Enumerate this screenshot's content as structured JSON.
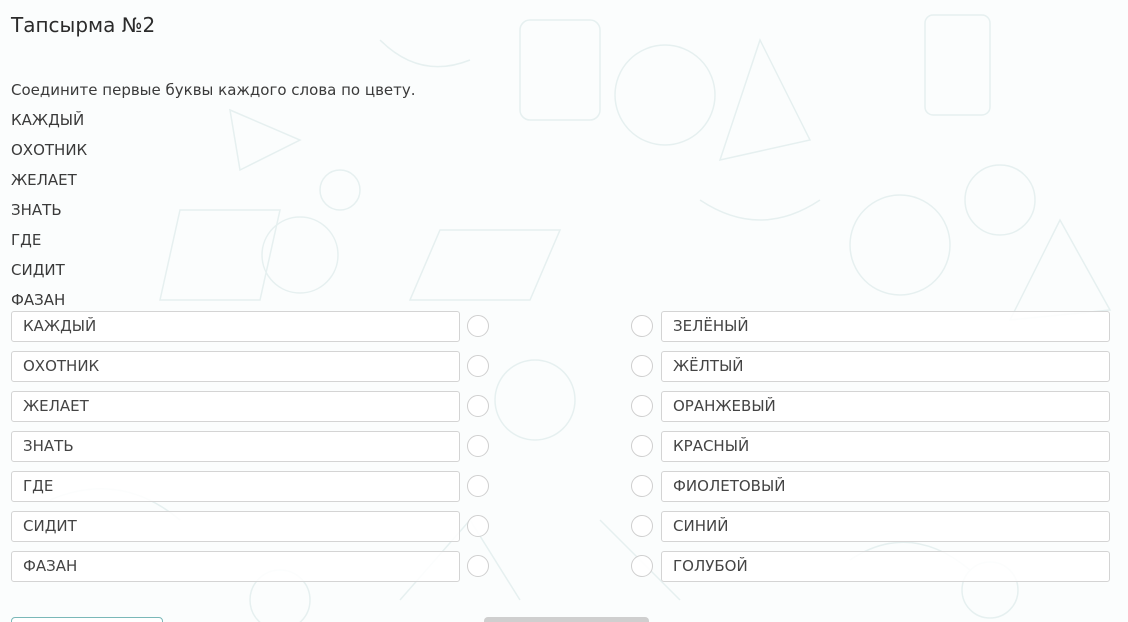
{
  "title": "Тапсырма №2",
  "instruction": "Соедините первые буквы каждого слова по цвету.",
  "words": [
    "КАЖДЫЙ",
    "ОХОТНИК",
    "ЖЕЛАЕТ",
    "ЗНАТЬ",
    "ГДЕ",
    "СИДИТ",
    "ФАЗАН"
  ],
  "left_items": [
    "КАЖДЫЙ",
    "ОХОТНИК",
    "ЖЕЛАЕТ",
    "ЗНАТЬ",
    "ГДЕ",
    "СИДИТ",
    "ФАЗАН"
  ],
  "right_items": [
    "ЗЕЛЁНЫЙ",
    "ЖЁЛТЫЙ",
    "ОРАНЖЕВЫЙ",
    "КРАСНЫЙ",
    "ФИОЛЕТОВЫЙ",
    "СИНИЙ",
    "ГОЛУБОЙ"
  ]
}
